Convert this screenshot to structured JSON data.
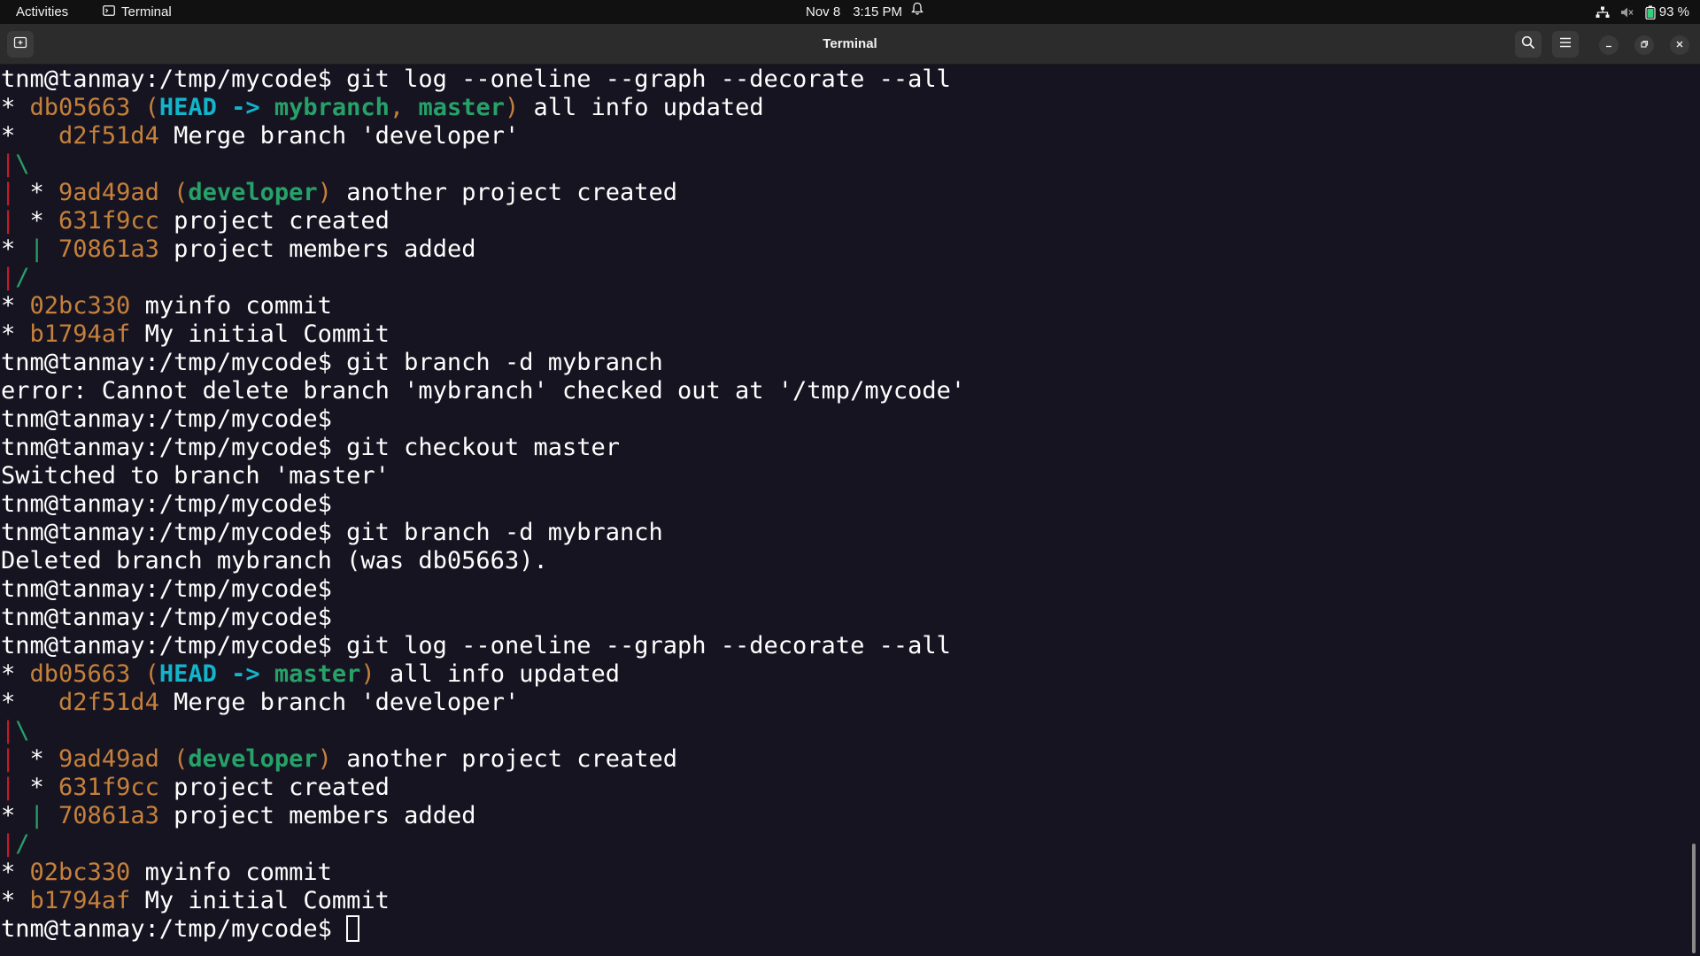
{
  "topbar": {
    "activities": "Activities",
    "app_name": "Terminal",
    "date": "Nov 8",
    "time": "3:15 PM",
    "battery": "93 %",
    "icons": [
      "network-icon",
      "volume-muted-icon",
      "battery-icon",
      "bell-icon",
      "terminal-app-icon"
    ]
  },
  "window": {
    "title": "Terminal",
    "buttons": [
      "new-tab",
      "search",
      "menu",
      "minimize",
      "maximize",
      "close"
    ]
  },
  "colors": {
    "background": "#171421",
    "hash": "#c5813b",
    "head_ref": "#12b5cb",
    "branch_ref": "#26a269",
    "graph_line": "#c4a000"
  },
  "terminal": {
    "prompt": "tnm@tanmay:/tmp/mycode$",
    "lines": [
      {
        "segs": [
          {
            "t": "tnm@tanmay:/tmp/mycode$ git log --oneline --graph --decorate --all",
            "c": "c-white"
          }
        ]
      },
      {
        "segs": [
          {
            "t": "* ",
            "c": "c-white"
          },
          {
            "t": "db05663 (",
            "c": "c-hash"
          },
          {
            "t": "HEAD -> ",
            "c": "c-head"
          },
          {
            "t": "mybranch",
            "c": "c-branch"
          },
          {
            "t": ", ",
            "c": "c-hash"
          },
          {
            "t": "master",
            "c": "c-branch"
          },
          {
            "t": ")",
            "c": "c-hash"
          },
          {
            "t": " all info updated",
            "c": "c-white"
          }
        ]
      },
      {
        "segs": [
          {
            "t": "*   ",
            "c": "c-white"
          },
          {
            "t": "d2f51d4",
            "c": "c-hash"
          },
          {
            "t": " Merge branch 'developer'",
            "c": "c-white"
          }
        ]
      },
      {
        "segs": [
          {
            "t": "|",
            "c": "c-red"
          },
          {
            "t": "\\",
            "c": "c-green"
          }
        ]
      },
      {
        "segs": [
          {
            "t": "|",
            "c": "c-red"
          },
          {
            "t": " * ",
            "c": "c-white"
          },
          {
            "t": "9ad49ad (",
            "c": "c-hash"
          },
          {
            "t": "developer",
            "c": "c-branch"
          },
          {
            "t": ")",
            "c": "c-hash"
          },
          {
            "t": " another project created",
            "c": "c-white"
          }
        ]
      },
      {
        "segs": [
          {
            "t": "|",
            "c": "c-red"
          },
          {
            "t": " * ",
            "c": "c-white"
          },
          {
            "t": "631f9cc",
            "c": "c-hash"
          },
          {
            "t": " project created",
            "c": "c-white"
          }
        ]
      },
      {
        "segs": [
          {
            "t": "* ",
            "c": "c-white"
          },
          {
            "t": "|",
            "c": "c-green"
          },
          {
            "t": " ",
            "c": "c-white"
          },
          {
            "t": "70861a3",
            "c": "c-hash"
          },
          {
            "t": " project members added",
            "c": "c-white"
          }
        ]
      },
      {
        "segs": [
          {
            "t": "|",
            "c": "c-red"
          },
          {
            "t": "/",
            "c": "c-green"
          }
        ]
      },
      {
        "segs": [
          {
            "t": "* ",
            "c": "c-white"
          },
          {
            "t": "02bc330",
            "c": "c-hash"
          },
          {
            "t": " myinfo commit",
            "c": "c-white"
          }
        ]
      },
      {
        "segs": [
          {
            "t": "* ",
            "c": "c-white"
          },
          {
            "t": "b1794af",
            "c": "c-hash"
          },
          {
            "t": " My initial Commit",
            "c": "c-white"
          }
        ]
      },
      {
        "segs": [
          {
            "t": "tnm@tanmay:/tmp/mycode$ git branch -d mybranch",
            "c": "c-white"
          }
        ]
      },
      {
        "segs": [
          {
            "t": "error: Cannot delete branch 'mybranch' checked out at '/tmp/mycode'",
            "c": "c-white"
          }
        ]
      },
      {
        "segs": [
          {
            "t": "tnm@tanmay:/tmp/mycode$",
            "c": "c-white"
          }
        ]
      },
      {
        "segs": [
          {
            "t": "tnm@tanmay:/tmp/mycode$ git checkout master",
            "c": "c-white"
          }
        ]
      },
      {
        "segs": [
          {
            "t": "Switched to branch 'master'",
            "c": "c-white"
          }
        ]
      },
      {
        "segs": [
          {
            "t": "tnm@tanmay:/tmp/mycode$",
            "c": "c-white"
          }
        ]
      },
      {
        "segs": [
          {
            "t": "tnm@tanmay:/tmp/mycode$ git branch -d mybranch",
            "c": "c-white"
          }
        ]
      },
      {
        "segs": [
          {
            "t": "Deleted branch mybranch (was db05663).",
            "c": "c-white"
          }
        ]
      },
      {
        "segs": [
          {
            "t": "tnm@tanmay:/tmp/mycode$",
            "c": "c-white"
          }
        ]
      },
      {
        "segs": [
          {
            "t": "tnm@tanmay:/tmp/mycode$",
            "c": "c-white"
          }
        ]
      },
      {
        "segs": [
          {
            "t": "tnm@tanmay:/tmp/mycode$ git log --oneline --graph --decorate --all",
            "c": "c-white"
          }
        ]
      },
      {
        "segs": [
          {
            "t": "* ",
            "c": "c-white"
          },
          {
            "t": "db05663 (",
            "c": "c-hash"
          },
          {
            "t": "HEAD -> ",
            "c": "c-head"
          },
          {
            "t": "master",
            "c": "c-branch"
          },
          {
            "t": ")",
            "c": "c-hash"
          },
          {
            "t": " all info updated",
            "c": "c-white"
          }
        ]
      },
      {
        "segs": [
          {
            "t": "*   ",
            "c": "c-white"
          },
          {
            "t": "d2f51d4",
            "c": "c-hash"
          },
          {
            "t": " Merge branch 'developer'",
            "c": "c-white"
          }
        ]
      },
      {
        "segs": [
          {
            "t": "|",
            "c": "c-red"
          },
          {
            "t": "\\",
            "c": "c-green"
          }
        ]
      },
      {
        "segs": [
          {
            "t": "|",
            "c": "c-red"
          },
          {
            "t": " * ",
            "c": "c-white"
          },
          {
            "t": "9ad49ad (",
            "c": "c-hash"
          },
          {
            "t": "developer",
            "c": "c-branch"
          },
          {
            "t": ")",
            "c": "c-hash"
          },
          {
            "t": " another project created",
            "c": "c-white"
          }
        ]
      },
      {
        "segs": [
          {
            "t": "|",
            "c": "c-red"
          },
          {
            "t": " * ",
            "c": "c-white"
          },
          {
            "t": "631f9cc",
            "c": "c-hash"
          },
          {
            "t": " project created",
            "c": "c-white"
          }
        ]
      },
      {
        "segs": [
          {
            "t": "* ",
            "c": "c-white"
          },
          {
            "t": "|",
            "c": "c-green"
          },
          {
            "t": " ",
            "c": "c-white"
          },
          {
            "t": "70861a3",
            "c": "c-hash"
          },
          {
            "t": " project members added",
            "c": "c-white"
          }
        ]
      },
      {
        "segs": [
          {
            "t": "|",
            "c": "c-red"
          },
          {
            "t": "/",
            "c": "c-green"
          }
        ]
      },
      {
        "segs": [
          {
            "t": "* ",
            "c": "c-white"
          },
          {
            "t": "02bc330",
            "c": "c-hash"
          },
          {
            "t": " myinfo commit",
            "c": "c-white"
          }
        ]
      },
      {
        "segs": [
          {
            "t": "* ",
            "c": "c-white"
          },
          {
            "t": "b1794af",
            "c": "c-hash"
          },
          {
            "t": " My initial Commit",
            "c": "c-white"
          }
        ]
      },
      {
        "segs": [
          {
            "t": "tnm@tanmay:/tmp/mycode$ ",
            "c": "c-white"
          }
        ],
        "cursor": true
      }
    ]
  }
}
